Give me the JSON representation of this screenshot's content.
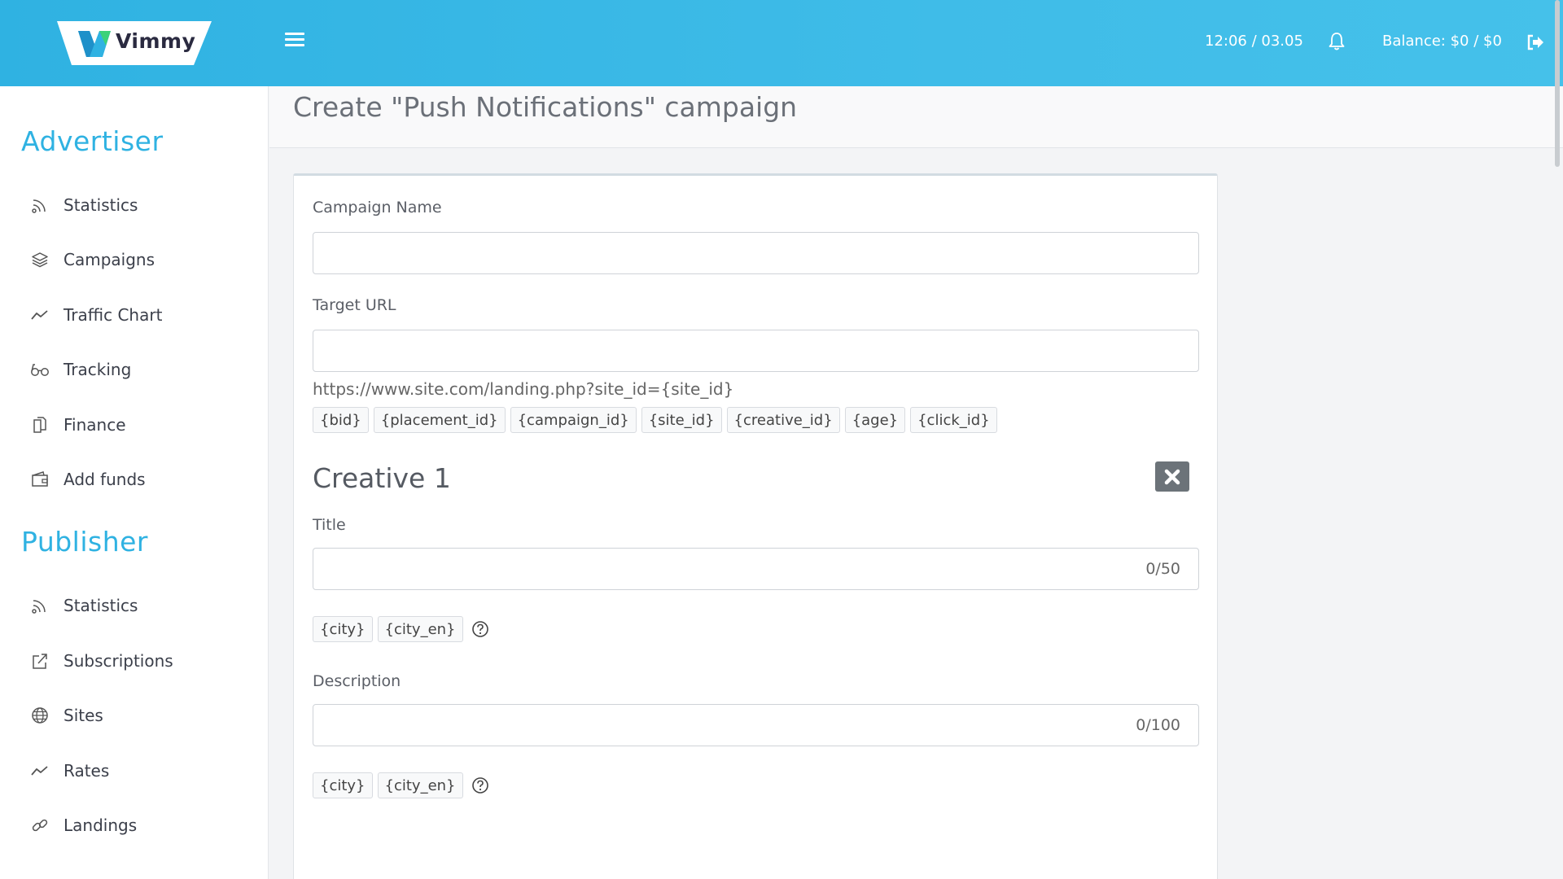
{
  "header": {
    "logo_text": "Vimmy",
    "time": "12:06 / 03.05",
    "balance": "Balance: $0 / $0",
    "icons": [
      "menu-icon",
      "bell-icon",
      "logout-icon"
    ]
  },
  "sidebar": {
    "advertiser_heading": "Advertiser",
    "advertiser_items": [
      {
        "label": "Statistics",
        "icon": "rss-icon"
      },
      {
        "label": "Campaigns",
        "icon": "layers-icon"
      },
      {
        "label": "Traffic Chart",
        "icon": "trend-icon"
      },
      {
        "label": "Tracking",
        "icon": "glasses-icon"
      },
      {
        "label": "Finance",
        "icon": "documents-icon"
      },
      {
        "label": "Add funds",
        "icon": "wallet-icon"
      }
    ],
    "publisher_heading": "Publisher",
    "publisher_items": [
      {
        "label": "Statistics",
        "icon": "rss-icon"
      },
      {
        "label": "Subscriptions",
        "icon": "share-icon"
      },
      {
        "label": "Sites",
        "icon": "globe-icon"
      },
      {
        "label": "Rates",
        "icon": "trend-icon"
      },
      {
        "label": "Landings",
        "icon": "link-icon"
      }
    ]
  },
  "page": {
    "title": "Create \"Push Notifications\" campaign"
  },
  "form": {
    "campaign_name_label": "Campaign Name",
    "campaign_name_value": "",
    "target_url_label": "Target URL",
    "target_url_value": "",
    "url_hint": "https://www.site.com/landing.php?site_id={site_id}",
    "url_macros": [
      "{bid}",
      "{placement_id}",
      "{campaign_id}",
      "{site_id}",
      "{creative_id}",
      "{age}",
      "{click_id}"
    ],
    "creative": {
      "heading": "Creative 1",
      "title_label": "Title",
      "title_value": "",
      "title_counter": "0/50",
      "title_macros": [
        "{city}",
        "{city_en}"
      ],
      "description_label": "Description",
      "description_value": "",
      "description_counter": "0/100",
      "description_macros": [
        "{city}",
        "{city_en}"
      ]
    }
  },
  "colors": {
    "accent": "#2fb2e2",
    "topbar_start": "#2fb2e2",
    "topbar_end": "#45c1ea",
    "remove_button": "#6c7379"
  }
}
